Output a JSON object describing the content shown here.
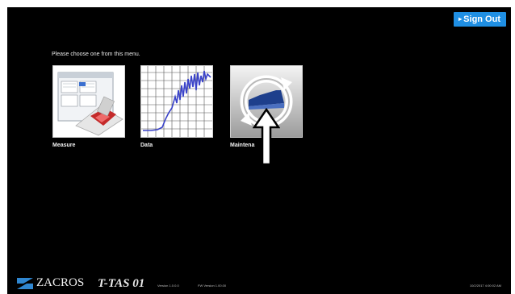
{
  "header": {
    "signout_label": "Sign Out"
  },
  "main": {
    "prompt": "Please choose one from this menu.",
    "tiles": [
      {
        "label": "Measure",
        "icon": "measure-icon"
      },
      {
        "label": "Data",
        "icon": "data-chart-icon"
      },
      {
        "label": "Maintena",
        "icon": "maintenance-icon"
      }
    ]
  },
  "footer": {
    "brand": "ZACROS",
    "product": "T-TAS 01",
    "version": "Version 1.0.0.0",
    "fw_version": "FW Version 1.00.00",
    "datetime": "10/2/2017 4:00:02 AM"
  },
  "colors": {
    "background": "#000000",
    "signout": "#1f8fe3",
    "maintenance_blue": "#1e3f8c"
  }
}
